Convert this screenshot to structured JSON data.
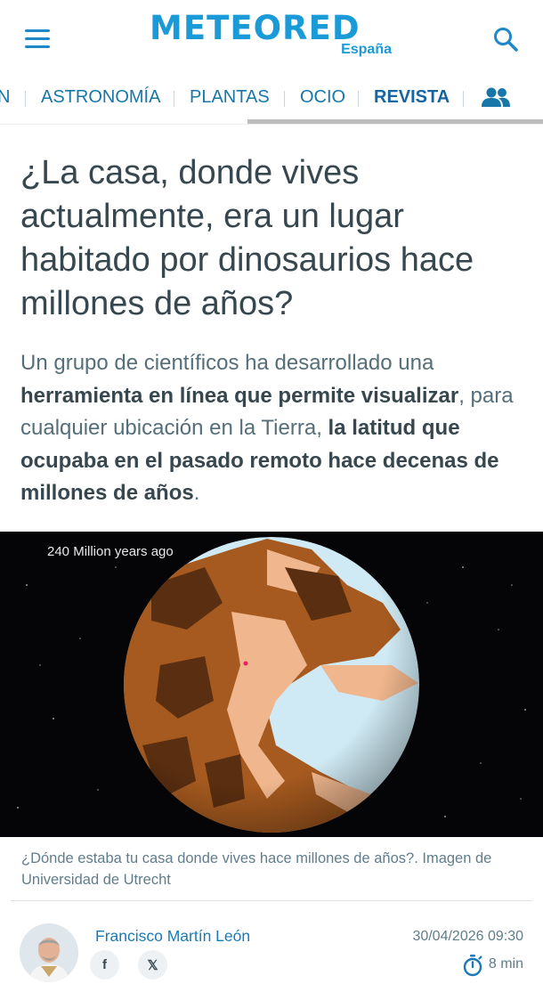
{
  "header": {
    "logo_text": "METEORED",
    "logo_sub": "España"
  },
  "nav": {
    "items": [
      {
        "label": "N"
      },
      {
        "label": "ASTRONOMÍA"
      },
      {
        "label": "PLANTAS"
      },
      {
        "label": "OCIO"
      },
      {
        "label": "REVISTA",
        "active": true
      }
    ]
  },
  "article": {
    "title": "¿La casa, donde vives actualmente, era un lugar habitado por dinosaurios hace millones de años?",
    "lead": {
      "t1": "Un grupo de científicos ha desarrollado una ",
      "b1": "herramienta en línea que permite visualizar",
      "t2": ", para cualquier ubicación en la Tierra, ",
      "b2": "la latitud que ocupaba en el pasado remoto hace decenas de millones de años",
      "t3": "."
    },
    "image_label": "240 Million years ago",
    "caption": "¿Dónde estaba tu casa donde vives hace millones de años?. Imagen de Universidad de Utrecht"
  },
  "author": {
    "name": "Francisco Martín León",
    "date": "30/04/2026 09:30",
    "read_time": "8 min",
    "facebook_label": "f",
    "x_label": "𝕏"
  },
  "colors": {
    "brand": "#1a9ad6",
    "land": "#a65a1f",
    "ocean": "#cfeaf4"
  }
}
